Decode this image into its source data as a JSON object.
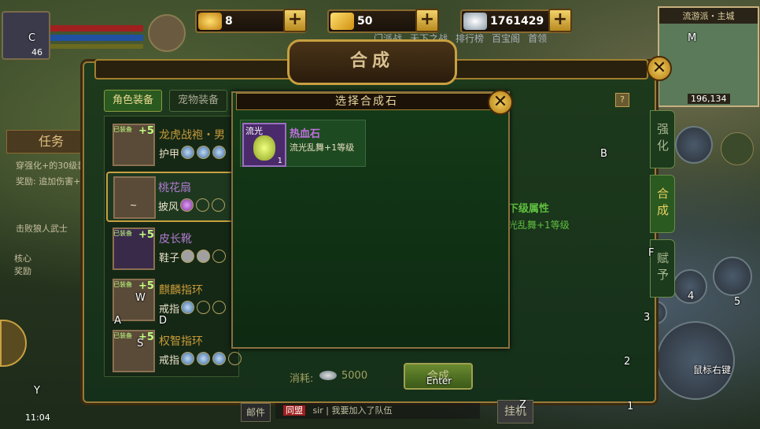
{
  "currency": {
    "gold_ingot": "8",
    "gold_bar": "50",
    "silver": "1761429",
    "plus": "+"
  },
  "window": {
    "title": "合成",
    "close": "✕"
  },
  "tabs": {
    "role_equipment": "角色装备",
    "pet_equipment": "宠物装备"
  },
  "equipment_list": [
    {
      "name": "龙虎战袍・男",
      "slot": "护甲",
      "name_color": "#c89a3a",
      "badge": "已装备",
      "level": "+5"
    },
    {
      "name": "桃花扇",
      "slot": "披风",
      "name_color": "#b07ad0",
      "badge": "",
      "level": "~"
    },
    {
      "name": "皮长靴",
      "slot": "鞋子",
      "name_color": "#b07ad0",
      "badge": "已装备",
      "level": "+5"
    },
    {
      "name": "麒麟指环",
      "slot": "戒指",
      "name_color": "#c89a3a",
      "badge": "已装备",
      "level": "+5"
    },
    {
      "name": "权智指环",
      "slot": "戒指",
      "name_color": "#c89a3a",
      "badge": "已装备",
      "level": "+5"
    }
  ],
  "side_tabs": [
    "强化",
    "合成",
    "赋予"
  ],
  "popup": {
    "title": "选择合成石",
    "close": "✕",
    "stone": {
      "tag": "流光",
      "name": "热血石",
      "desc": "流光乱舞+1等级",
      "count": "1"
    }
  },
  "behind": {
    "next_attr": "下级属性",
    "next_attr_value": "光乱舞+1等级",
    "cost_label": "消耗:",
    "cost_value": "5000",
    "confirm": "合成"
  },
  "left_hud": {
    "level": "46",
    "quest": "任务",
    "quest_text1": "穿强化+的30级装",
    "quest_text2": "奖励: 追加伤害+",
    "quest_text3": "击败狼人武士",
    "core_reward": "核心奖励",
    "time": "11:04"
  },
  "top_nav": [
    "门派战",
    "天下之战",
    "排行榜",
    "百宝阁",
    "首领"
  ],
  "minimap": {
    "title": "流游派・主城",
    "coords": "196,134"
  },
  "bottom": {
    "mail": "邮件",
    "chat_tag": "同盟",
    "chat_text": "sir | 我要加入了队伍",
    "hang": "挂机",
    "zone_hint": "鼠标右键"
  },
  "keyhints": {
    "C": "C",
    "M": "M",
    "B": "B",
    "F": "F",
    "W": "W",
    "A": "A",
    "S": "S",
    "D": "D",
    "Y": "Y",
    "Z": "Z",
    "Enter": "Enter",
    "k1": "1",
    "k2": "2",
    "k3": "3",
    "k4": "4",
    "k5": "5",
    "rclick": "鼠标右键"
  }
}
